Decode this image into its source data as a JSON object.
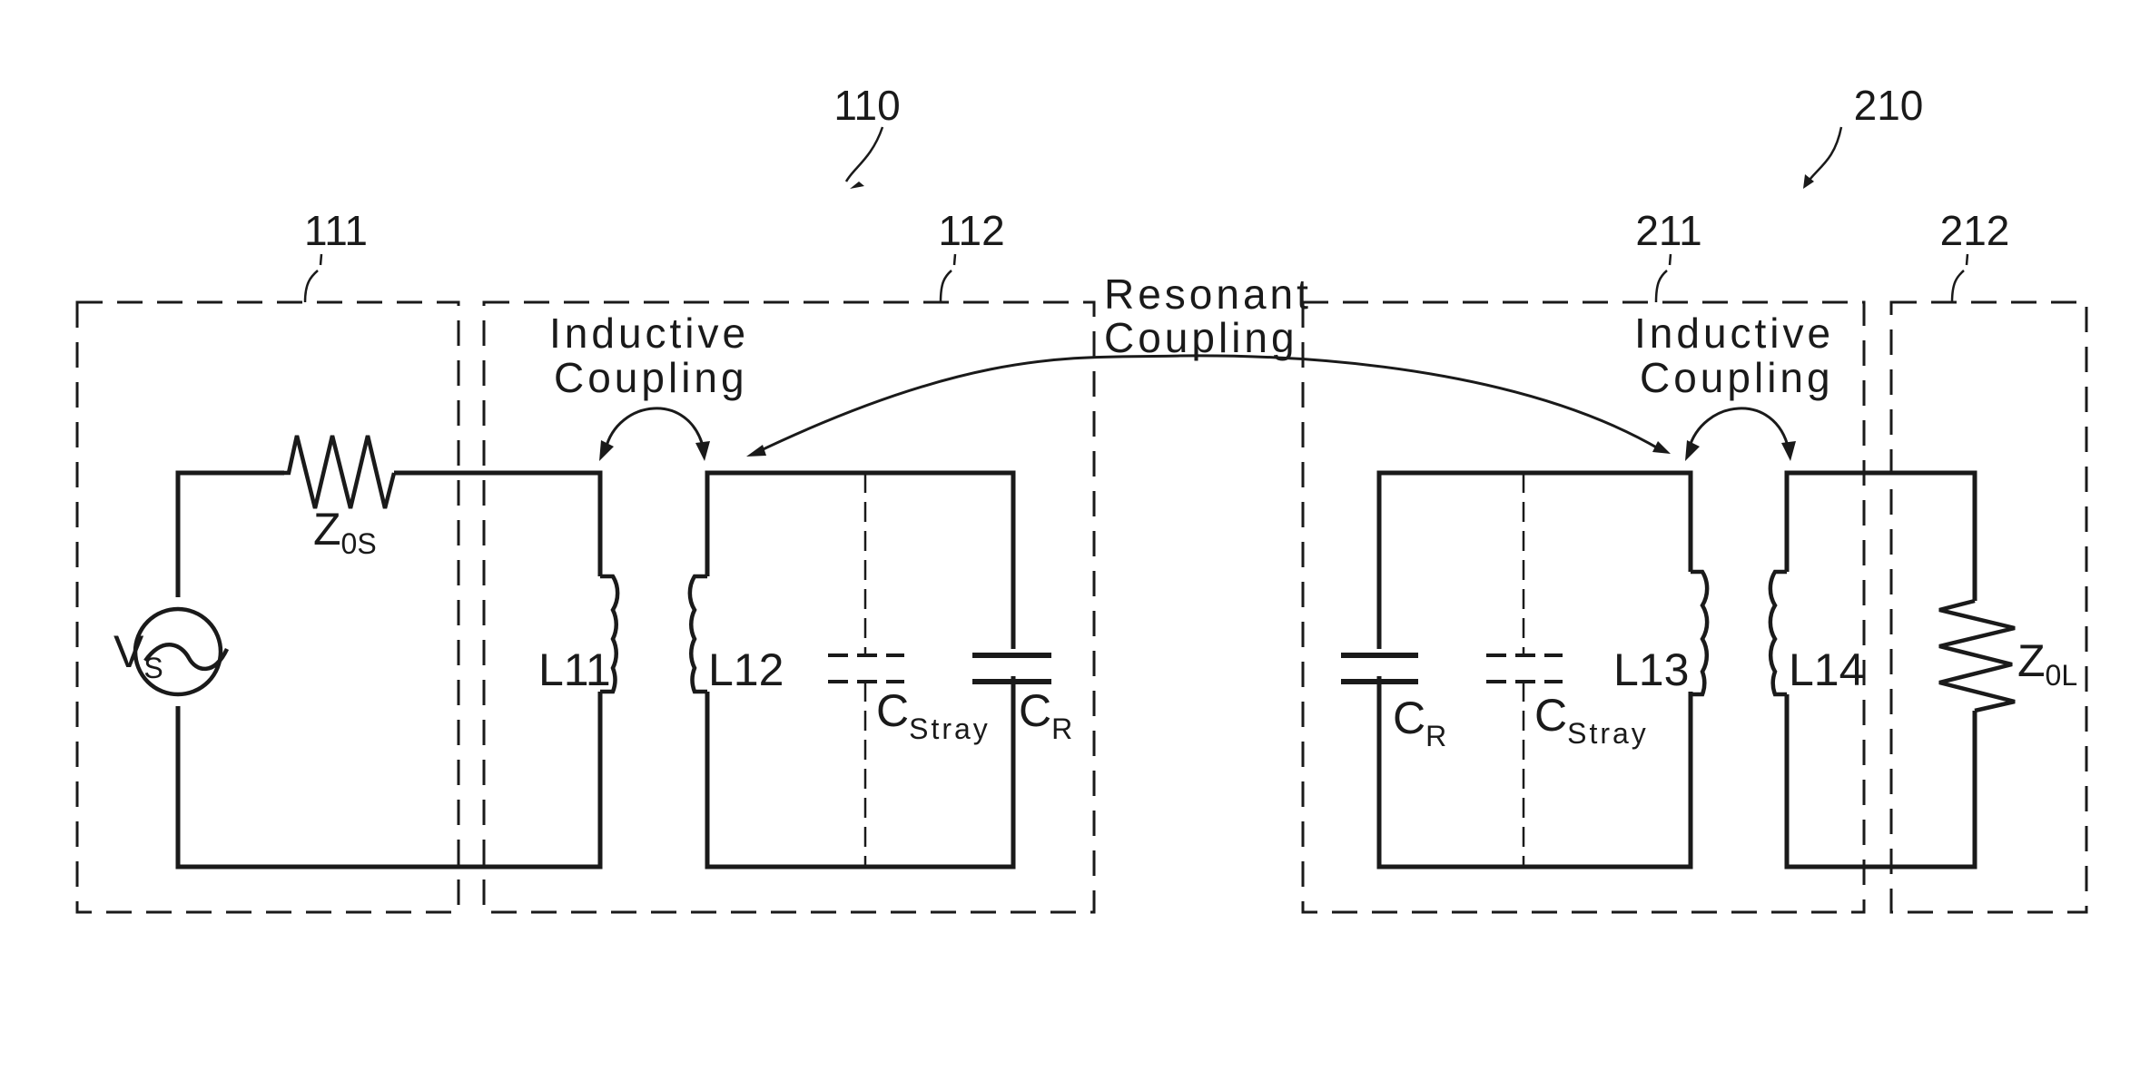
{
  "diagram": {
    "type": "circuit-schematic",
    "reference_numerals": {
      "transmitter": "110",
      "receiver": "210",
      "source_block": "111",
      "tx_resonator_block": "112",
      "rx_resonator_block": "211",
      "load_block": "212"
    },
    "coupling_labels": {
      "inductive_tx_line1": "Inductive",
      "inductive_tx_line2": "Coupling",
      "resonant_line1": "Resonant",
      "resonant_line2": "Coupling",
      "inductive_rx_line1": "Inductive",
      "inductive_rx_line2": "Coupling"
    },
    "components": {
      "source": {
        "main": "V",
        "sub": "S"
      },
      "source_impedance": {
        "main": "Z",
        "sub": "0S"
      },
      "inductor_l11": "L11",
      "inductor_l12": "L12",
      "tx_stray_cap": {
        "main": "C",
        "sub": "Stray"
      },
      "tx_resonant_cap": {
        "main": "C",
        "sub": "R"
      },
      "rx_resonant_cap": {
        "main": "C",
        "sub": "R"
      },
      "rx_stray_cap": {
        "main": "C",
        "sub": "Stray"
      },
      "inductor_l13": "L13",
      "inductor_l14": "L14",
      "load_impedance": {
        "main": "Z",
        "sub": "0L"
      }
    },
    "colors": {
      "ink": "#1a1a1a",
      "background": "#ffffff"
    }
  }
}
